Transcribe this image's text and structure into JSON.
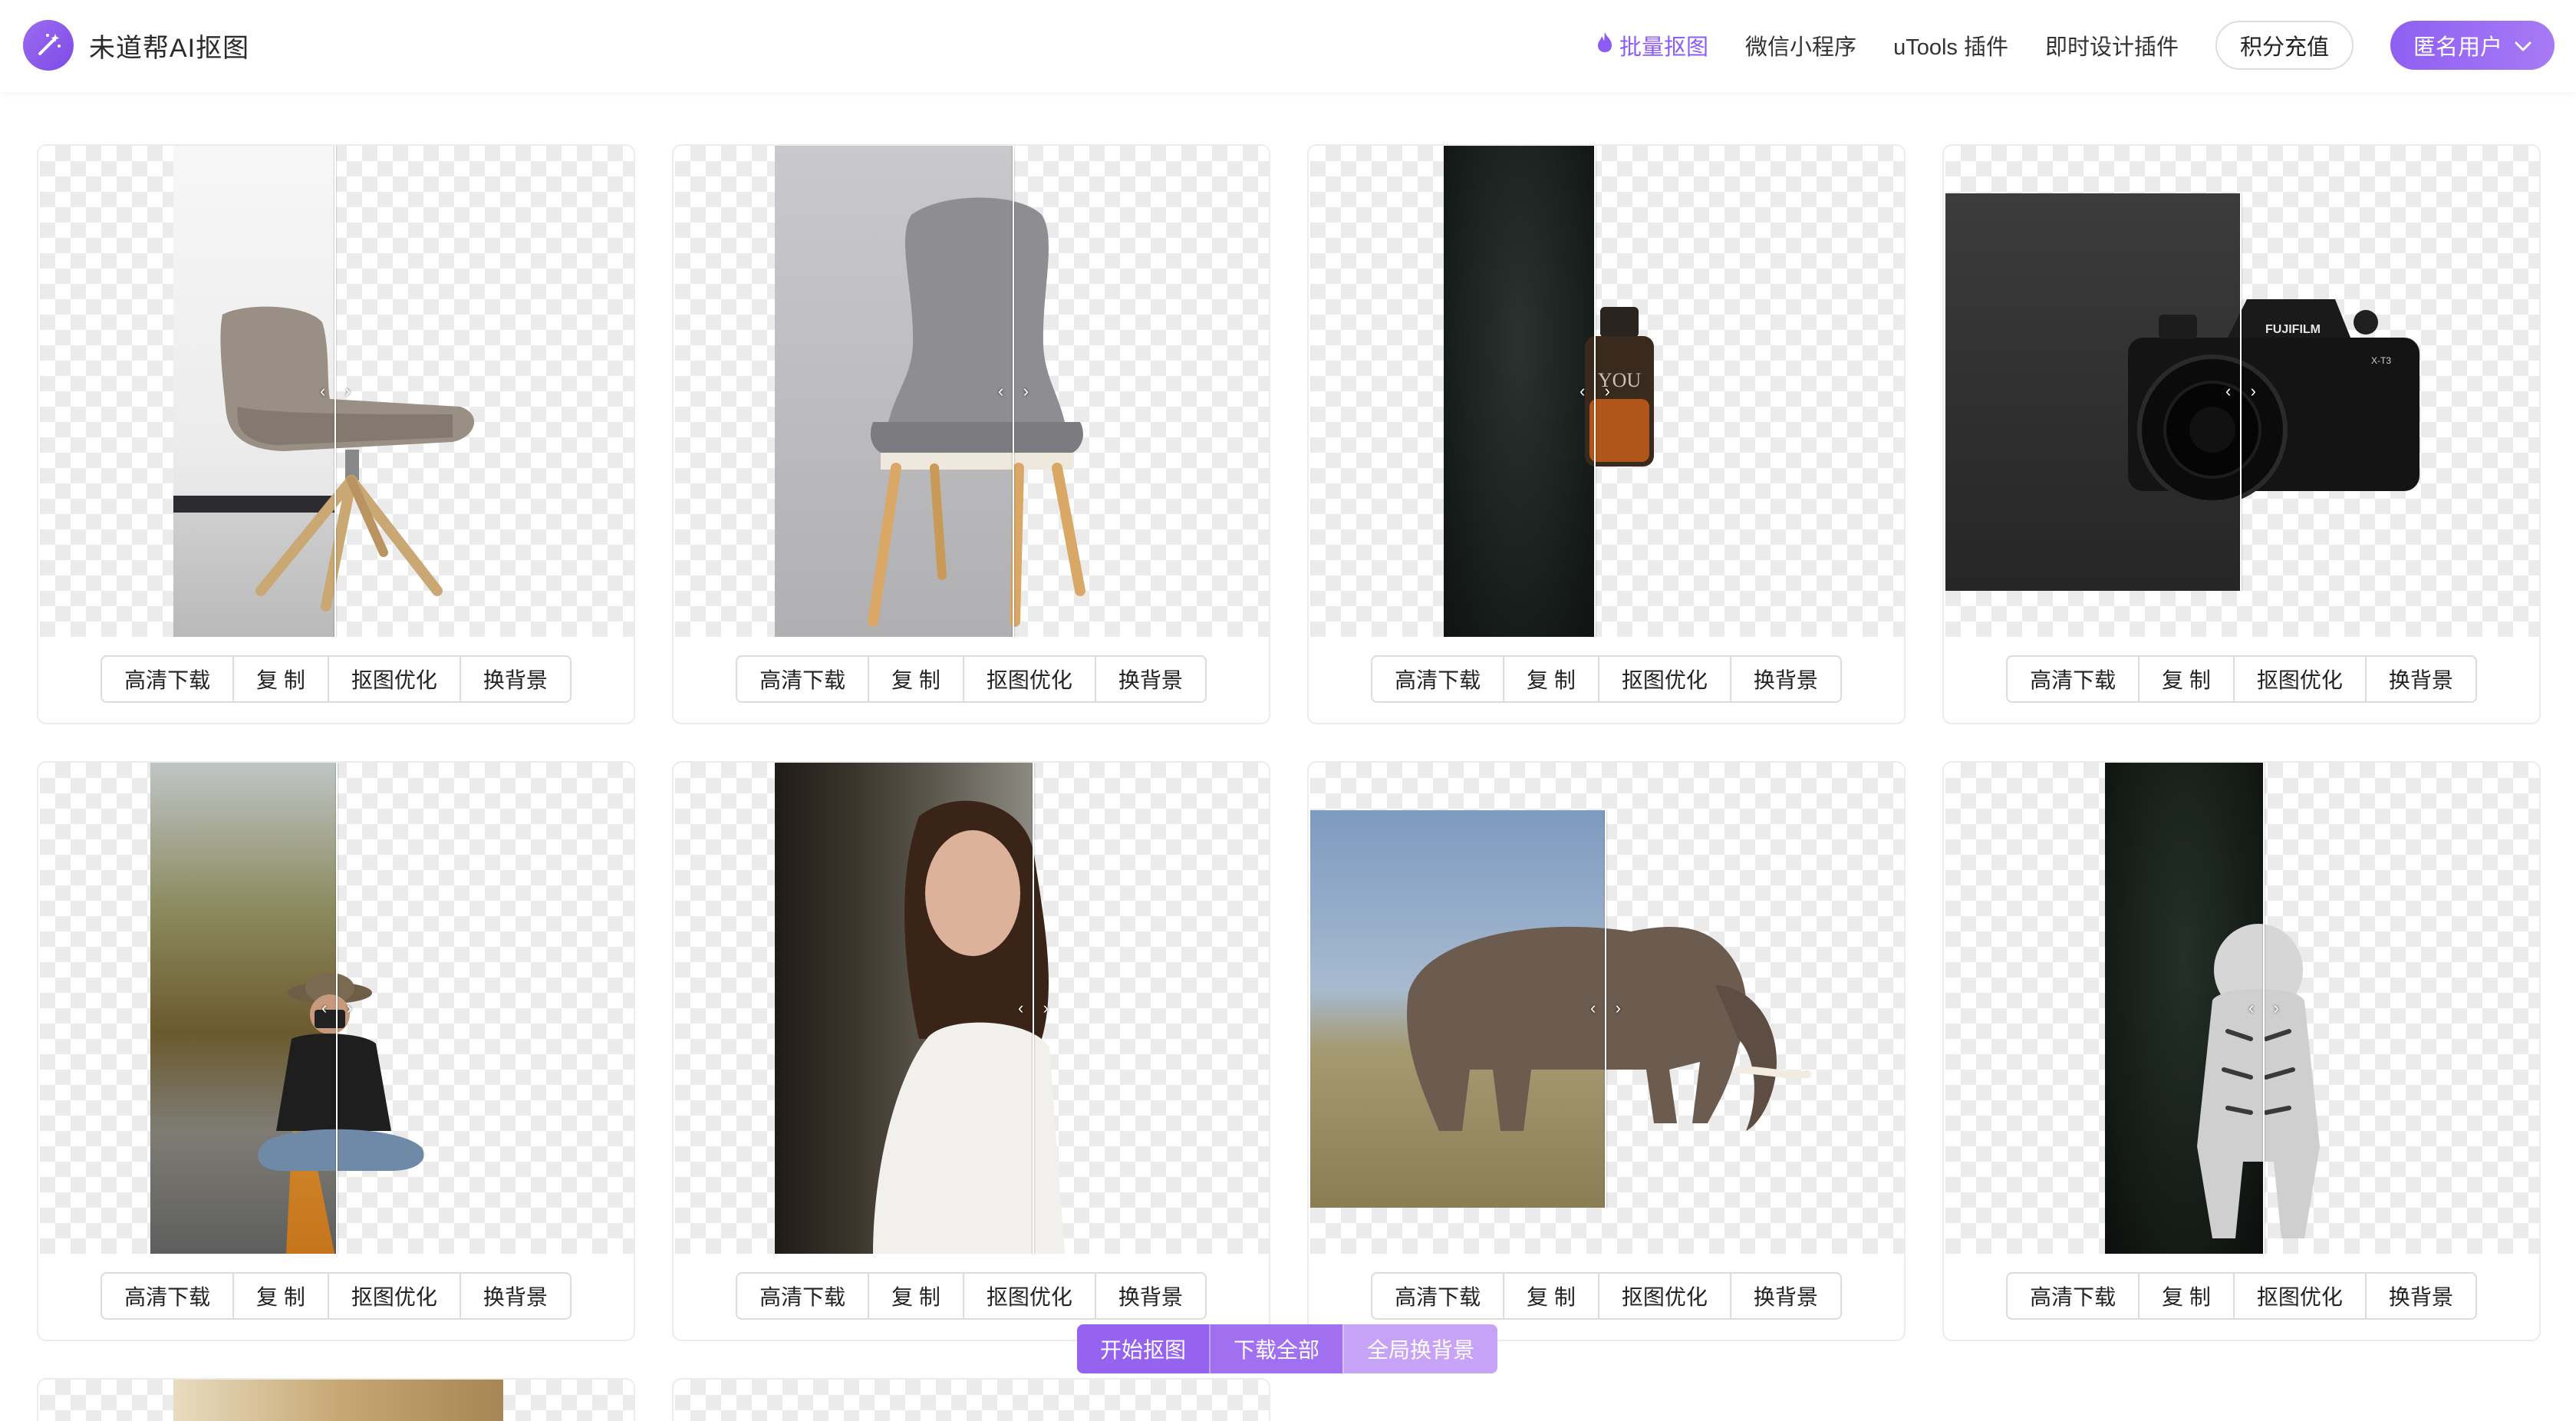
{
  "app": {
    "title": "未道帮AI抠图",
    "brand_color": "#8b5cf6"
  },
  "nav": {
    "items": [
      {
        "label": "批量抠图",
        "active": true,
        "icon": "flame-icon"
      },
      {
        "label": "微信小程序",
        "active": false
      },
      {
        "label": "uTools 插件",
        "active": false
      },
      {
        "label": "即时设计插件",
        "active": false
      }
    ],
    "points_button": "积分充值",
    "user_button": "匿名用户"
  },
  "card_actions": [
    "高清下载",
    "复 制",
    "抠图优化",
    "换背景"
  ],
  "cards": [
    {
      "subject": "chair"
    },
    {
      "subject": "chair"
    },
    {
      "subject": "perfume-bottle"
    },
    {
      "subject": "camera",
      "brand_text": "FUJIFILM",
      "model_text": "X-T3"
    },
    {
      "subject": "photographer"
    },
    {
      "subject": "woman"
    },
    {
      "subject": "elephant"
    },
    {
      "subject": "tiger"
    }
  ],
  "perfume_label": "YOU",
  "toolbar": {
    "start": "开始抠图",
    "download_all": "下载全部",
    "global_bg": "全局换背景"
  }
}
